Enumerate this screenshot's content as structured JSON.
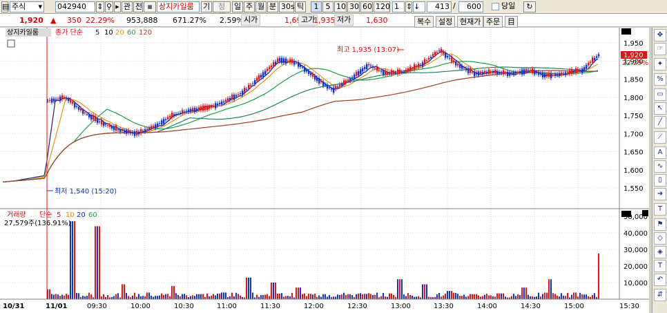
{
  "toolbar": {
    "market_select": "주식",
    "stock_code": "042940",
    "btn_gwan": "관",
    "btn_jeon": "전",
    "stock_name": "상지카일룸",
    "btn_gi": "기",
    "btn_jeongche": "정체",
    "period_buttons": [
      "일",
      "주",
      "월",
      "분",
      "30s",
      "틱"
    ],
    "interval_buttons": [
      "1",
      "5",
      "10",
      "30",
      "60",
      "120"
    ],
    "interval_value": "1",
    "count_value": "413",
    "count_sep": "/",
    "count_max": "600",
    "today_label": "당일"
  },
  "info_bar": {
    "price": "1,920",
    "change_arrow": "▲",
    "change": "350",
    "change_pct": "22.29%",
    "volume": "953,888",
    "vol_ratio": "671.27%",
    "turnover": "2.59%",
    "open_label": "시가",
    "open": "1,695",
    "high_label": "고가",
    "high": "1,935",
    "low_label": "저가",
    "low": "1,630",
    "buttons": [
      "복수",
      "설정",
      "현재가",
      "주문",
      "目"
    ]
  },
  "price_panel": {
    "stock_label": "상지카일룸",
    "ma_label": "종가 단순",
    "ma_periods": [
      "5",
      "10",
      "20",
      "60",
      "120"
    ],
    "high_annotation": "최고 1,935 (13:07)",
    "low_annotation": "최저 1,540 (15:20)",
    "current_price_tag": "1,920",
    "current_pct_tag": "22.29%"
  },
  "volume_panel": {
    "label": "거래량",
    "ma_label": "단순",
    "ma_periods": [
      "5",
      "10",
      "20",
      "60"
    ],
    "current_volume": "27,579주(136.91%)"
  },
  "colors": {
    "up": "#e81010",
    "down": "#1030d0",
    "ma5": "#1a1a80",
    "ma10": "#e89010",
    "ma20": "#18a048",
    "ma60": "#208060",
    "ma120": "#a04020"
  },
  "chart_data": [
    {
      "type": "line",
      "title": "상지카일룸",
      "x_tick_labels": [
        "10/31",
        "11/01",
        "09:30",
        "10:00",
        "10:30",
        "11:00",
        "11:30",
        "12:00",
        "12:30",
        "13:00",
        "13:30",
        "14:00",
        "14:30",
        "15:00",
        "15:30"
      ],
      "y_tick_labels": [
        "1,550",
        "1,600",
        "1,650",
        "1,700",
        "1,750",
        "1,800",
        "1,850",
        "1,900",
        "1,950"
      ],
      "ylim": [
        1515,
        1965
      ],
      "x": [
        "10/31",
        "11/01",
        "09:05",
        "09:10",
        "09:15",
        "09:20",
        "09:30",
        "09:45",
        "10:00",
        "10:10",
        "10:20",
        "10:30",
        "10:45",
        "11:00",
        "11:10",
        "11:20",
        "11:30",
        "11:40",
        "11:50",
        "12:00",
        "12:10",
        "12:30",
        "12:50",
        "13:00",
        "13:07",
        "13:20",
        "13:40",
        "14:00",
        "14:15",
        "14:30",
        "14:45",
        "15:00",
        "15:10",
        "15:20"
      ],
      "series": [
        {
          "name": "종가",
          "values": [
            1565,
            1585,
            1790,
            1800,
            1760,
            1730,
            1710,
            1700,
            1720,
            1750,
            1765,
            1770,
            1790,
            1815,
            1860,
            1905,
            1895,
            1855,
            1820,
            1850,
            1890,
            1865,
            1870,
            1890,
            1930,
            1890,
            1865,
            1870,
            1865,
            1875,
            1860,
            1865,
            1875,
            1920
          ]
        }
      ]
    },
    {
      "type": "bar",
      "title": "거래량",
      "y_tick_labels": [
        "10,000",
        "20,000",
        "30,000",
        "40,000",
        "50,000"
      ],
      "ylim": [
        0,
        52000
      ],
      "x": [
        "11/01",
        "09:05",
        "09:10",
        "09:20",
        "09:40",
        "10:00",
        "10:20",
        "10:40",
        "11:00",
        "11:20",
        "11:30",
        "11:50",
        "12:00",
        "12:30",
        "13:00",
        "13:07",
        "13:30",
        "14:00",
        "14:30",
        "14:45",
        "15:00",
        "15:10",
        "15:20"
      ],
      "values": [
        6000,
        47000,
        44000,
        9000,
        4000,
        8000,
        3000,
        4000,
        13000,
        10000,
        7000,
        3000,
        3000,
        2500,
        12000,
        9000,
        5000,
        3000,
        3500,
        7000,
        12000,
        4000,
        27579
      ]
    }
  ]
}
